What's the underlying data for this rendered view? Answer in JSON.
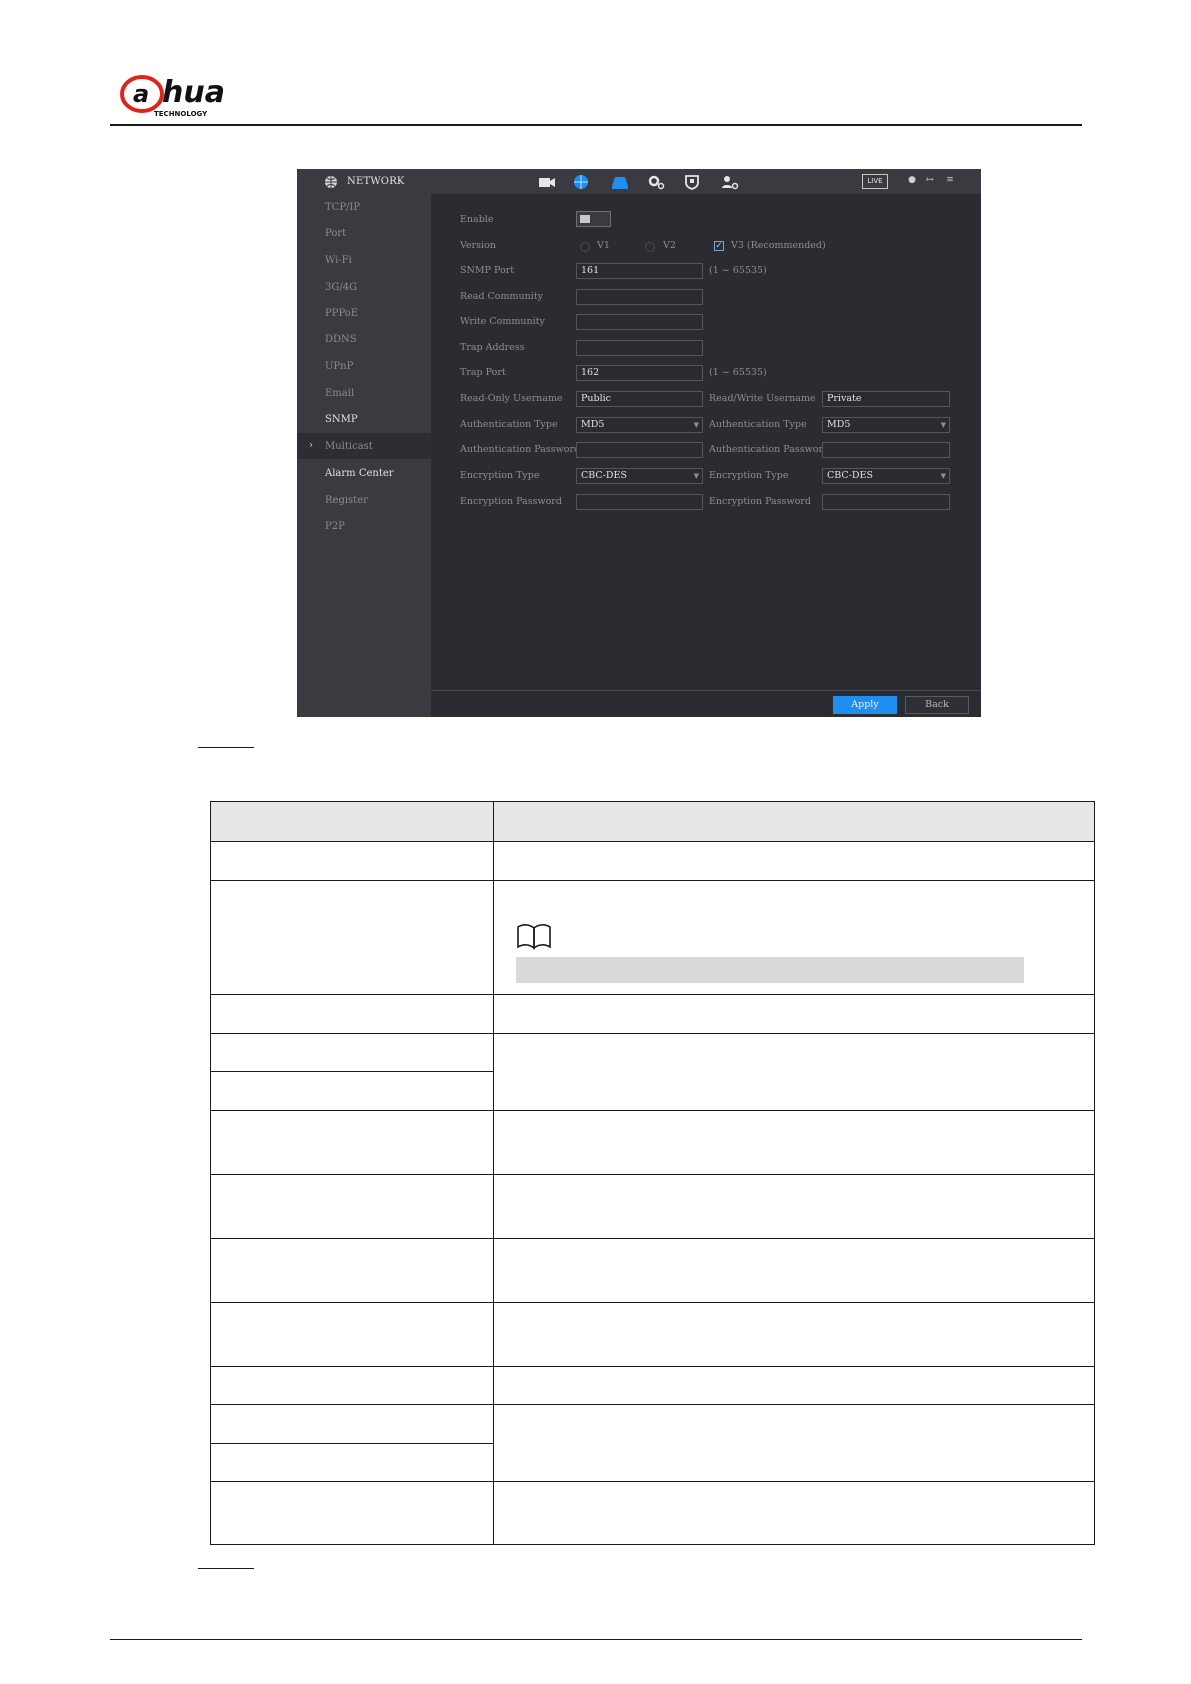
{
  "brand": {
    "logo_text": "alhua",
    "logo_sub": "TECHNOLOGY"
  },
  "screen": {
    "title": "NETWORK",
    "live_label": "LIVE",
    "sidebar": {
      "items": [
        "TCP/IP",
        "Port",
        "Wi-Fi",
        "3G/4G",
        "PPPoE",
        "DDNS",
        "UPnP",
        "Email",
        "SNMP",
        "Multicast",
        "Alarm Center",
        "Register",
        "P2P"
      ],
      "selected": "SNMP"
    },
    "form": {
      "enable_label": "Enable",
      "version_label": "Version",
      "v1": "V1",
      "v2": "V2",
      "v3": "V3 (Recommended)",
      "snmp_port_label": "SNMP Port",
      "snmp_port_value": "161",
      "snmp_port_range": "(1 ~ 65535)",
      "read_community_label": "Read Community",
      "write_community_label": "Write Community",
      "trap_address_label": "Trap Address",
      "trap_port_label": "Trap Port",
      "trap_port_value": "162",
      "trap_port_range": "(1 ~ 65535)",
      "ro_username_label": "Read-Only Username",
      "ro_username_value": "Public",
      "rw_username_label": "Read/Write Username",
      "rw_username_value": "Private",
      "auth_type_label_left": "Authentication Type",
      "auth_type_value_left": "MD5",
      "auth_type_label_right": "Authentication Type",
      "auth_type_value_right": "MD5",
      "auth_pwd_label_left": "Authentication Password",
      "auth_pwd_label_right": "Authentication Password",
      "enc_type_label_left": "Encryption Type",
      "enc_type_value_left": "CBC-DES",
      "enc_type_label_right": "Encryption Type",
      "enc_type_value_right": "CBC-DES",
      "enc_pwd_label_left": "Encryption Password",
      "enc_pwd_label_right": "Encryption Password"
    },
    "apply_label": "Apply",
    "back_label": "Back"
  }
}
